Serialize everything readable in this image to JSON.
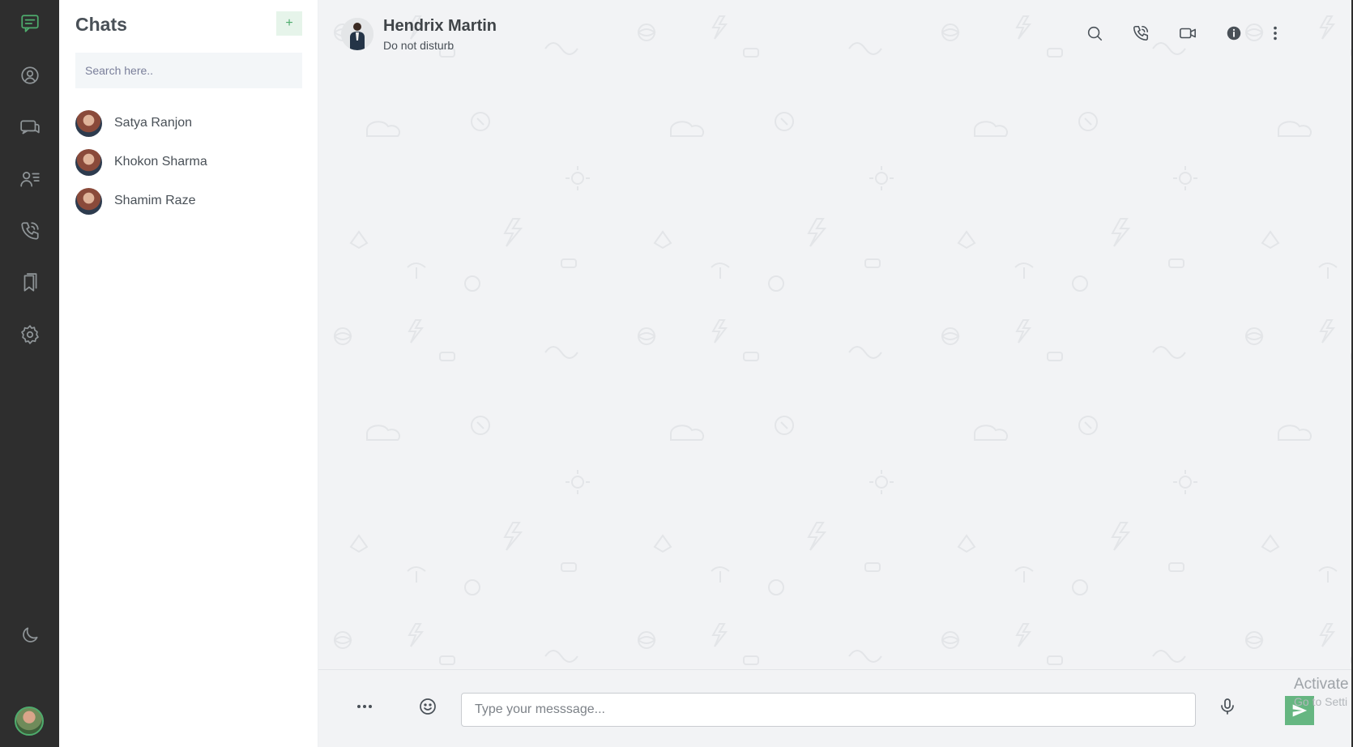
{
  "rail": {
    "items": [
      {
        "name": "chats-nav",
        "icon": "chat-icon",
        "active": true
      },
      {
        "name": "profile-nav",
        "icon": "user-circle-icon"
      },
      {
        "name": "groups-nav",
        "icon": "messages-icon"
      },
      {
        "name": "contacts-nav",
        "icon": "contacts-icon"
      },
      {
        "name": "calls-nav",
        "icon": "phone-call-icon"
      },
      {
        "name": "bookmarks-nav",
        "icon": "bookmark-icon"
      },
      {
        "name": "settings-nav",
        "icon": "gear-icon"
      }
    ],
    "theme_toggle_icon": "moon-icon"
  },
  "chats": {
    "title": "Chats",
    "add_label": "+",
    "search_placeholder": "Search here..",
    "items": [
      {
        "name": "Satya Ranjon"
      },
      {
        "name": "Khokon Sharma"
      },
      {
        "name": "Shamim Raze"
      }
    ]
  },
  "conversation": {
    "contact_name": "Hendrix Martin",
    "contact_status": "Do not disturb",
    "header_icons": [
      "search-icon",
      "phone-icon",
      "video-icon",
      "info-icon",
      "more-vertical-icon"
    ]
  },
  "composer": {
    "placeholder": "Type your messsage...",
    "more_icon": "more-horizontal-icon",
    "emoji_icon": "emoji-icon",
    "mic_icon": "mic-icon",
    "send_icon": "send-icon"
  },
  "watermark": {
    "line1": "Activate",
    "line2": "Go to Setti"
  },
  "colors": {
    "accent": "#4eac6d",
    "rail_bg": "#2e2e2e",
    "chat_bg": "#f2f3f5"
  }
}
